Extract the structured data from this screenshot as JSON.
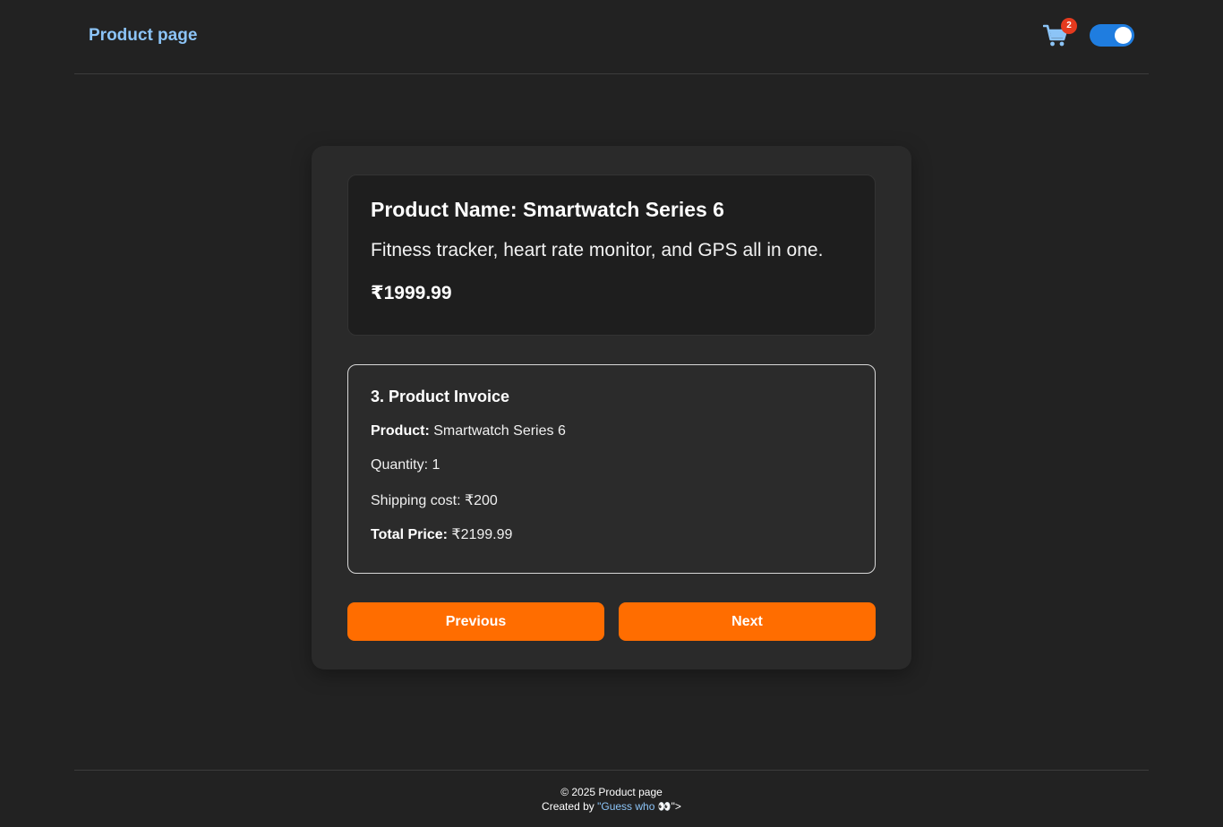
{
  "header": {
    "brand": "Product page",
    "cart_count": "2",
    "cart_icon": "cart-icon",
    "theme_toggle_on": true,
    "accent_color": "#1f7de0"
  },
  "product": {
    "name": "Product Name: Smartwatch Series 6",
    "description": "Fitness tracker, heart rate monitor, and GPS all in one.",
    "price": "₹1999.99"
  },
  "invoice": {
    "title": "3. Product Invoice",
    "product_label": "Product:",
    "product_value": " Smartwatch Series 6",
    "quantity": "Quantity: 1",
    "shipping": "Shipping cost: ₹200",
    "total_label": "Total Price:",
    "total_value": " ₹2199.99"
  },
  "buttons": {
    "previous": "Previous",
    "next": "Next",
    "color": "#ff6d00"
  },
  "footer": {
    "copyright": "© 2025 Product page",
    "credit_prefix": "Created by ",
    "credit_link": "\"Guess who 👀",
    "credit_suffix": "\">"
  }
}
